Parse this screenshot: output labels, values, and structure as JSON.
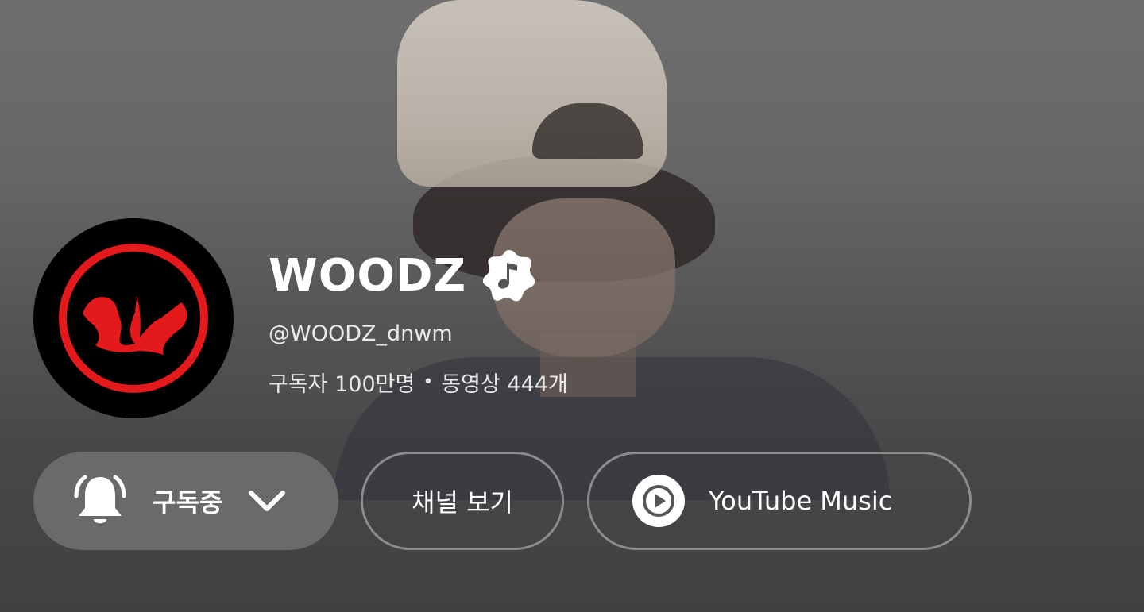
{
  "channel": {
    "name": "WOODZ",
    "handle": "@WOODZ_dnwm",
    "subscribers": "구독자 100만명",
    "separator": "•",
    "videos": "동영상 444개"
  },
  "icons": {
    "verified": "music-note-verified-icon",
    "bell": "bell-icon",
    "chevron": "chevron-down-icon",
    "play": "play-circle-icon"
  },
  "buttons": {
    "subscribed_label": "구독중",
    "view_channel_label": "채널 보기",
    "youtube_music_label": "YouTube Music"
  },
  "colors": {
    "avatar_red": "#e3191b",
    "avatar_bg": "#000000",
    "button_fill": "#6a6a6a",
    "outline": "#8c8c8c"
  }
}
